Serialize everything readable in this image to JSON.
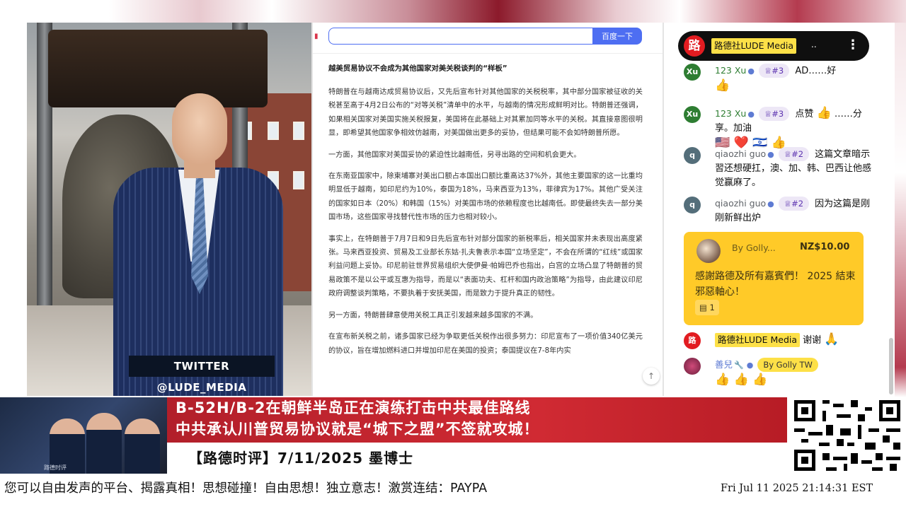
{
  "video": {
    "twitter_tag": "TWITTER  @LUDE_MEDIA"
  },
  "browser": {
    "search_value": "",
    "search_button": "百度一下",
    "article": {
      "title": "越美贸易协议不会成为其他国家对美关税谈判的“样板”",
      "paragraphs": [
        "特朗普在与越南达成贸易协议后，又先后宣布针对其他国家的关税税率，其中部分国家被征收的关税甚至高于4月2日公布的“对等关税”清单中的水平，与越南的情况形成鲜明对比。特朗普还强调，如果相关国家对美国实施关税报复，美国将在此基础上对其累加同等水平的关税。其直接意图很明显，即希望其他国家争相效仿越南，对美国做出更多的妥协，但结果可能不会如特朗普所愿。",
        "一方面，其他国家对美国妥协的紧迫性比越南低，另寻出路的空间和机会更大。",
        "在东南亚国家中，除柬埔寨对美出口额占本国出口额比重高达37%外，其他主要国家的这一比重均明显低于越南，如印尼约为10%，泰国为18%，马来西亚为13%，菲律宾为17%。其他广受关注的国家如日本（20%）和韩国（15%）对美国市场的依赖程度也比越南低。即使最终失去一部分美国市场，这些国家寻找替代性市场的压力也相对较小。",
        "事实上，在特朗普于7月7日和9日先后宣布针对部分国家的新税率后，相关国家并未表现出高度紧张。马来西亚投资、贸易及工业部长东姑·扎夫鲁表示本国“立场坚定”，不会在所谓的“红线”或国家利益问题上妥协。印尼前驻世界贸易组织大使伊曼·帕姆巴乔也指出，白宫的立场凸显了特朗普的贸易政策不是以公平或互惠为指导，而是以“表面功夫、杠杆和国内政治策略”为指导，由此建议印尼政府调整谈判策略，不要执着于安抚美国，而是致力于提升真正的韧性。",
        "另一方面，特朗普肆意使用关税工具正引发越来越多国家的不满。",
        "在宣布新关税之前，诸多国家已经为争取更低关税作出很多努力：印尼宣布了一项价值340亿美元的协议，旨在增加燃料进口并增加印尼在美国的投资；泰国提议在7-8年内实"
      ]
    }
  },
  "chat": {
    "channel": {
      "logo": "路",
      "name": "路德社LUDE Media",
      "status": ".."
    },
    "messages": [
      {
        "avatar": "Xu",
        "author": "123 Xu",
        "badge": "♕#3",
        "text": "AD……好",
        "emoji": "👍"
      },
      {
        "avatar": "Xu",
        "author": "123 Xu",
        "badge": "♕#3",
        "text": "点赞",
        "emoji": "👍",
        "text2": "……分享。加油",
        "emoji2": "🇺🇸 ❤️ 🇮🇱 👍"
      },
      {
        "avatar": "q",
        "author": "qiaozhi guo",
        "badge": "♕#2",
        "text": "这篇文章暗示習还想硬扛，澳、加、韩、巴西让他感觉赢麻了。"
      },
      {
        "avatar": "q",
        "author": "qiaozhi guo",
        "badge": "♕#2",
        "text": "因为这篇是刚刚新鲜出炉"
      }
    ],
    "superchat": {
      "name": "By Golly...",
      "amount": "NZ$10.00",
      "text": "感謝路德及所有嘉賓們！ 2025 結束邪惡軸心！",
      "replies": "1"
    },
    "owner_message": {
      "logo": "路",
      "name": "路德社LUDE Media",
      "text": "谢谢",
      "emoji": "🙏"
    },
    "last_message": {
      "author": "善兒",
      "badge": "By Golly TW",
      "emoji": "👍 👍 👍"
    }
  },
  "banner": {
    "headline_1": "B-52H/B-2在朝鲜半岛正在演练打击中共最佳路线",
    "headline_2": "中共承认川普贸易协议就是“城下之盟”不签就攻城！",
    "subtitle": "【路德时评】7/11/2025 墨博士",
    "thumb_caption": "路德时评"
  },
  "ticker": {
    "text": "您可以自由发声的平台、揭露真相！思想碰撞！自由思想！独立意志！激赏连结：PAYPA",
    "clock": "Fri Jul 11 2025 21:14:31 EST"
  },
  "colors": {
    "headline_red": "#c8232d",
    "search_blue": "#4e6ef2",
    "superchat_yellow": "#ffca28",
    "owner_highlight": "#fde047"
  }
}
